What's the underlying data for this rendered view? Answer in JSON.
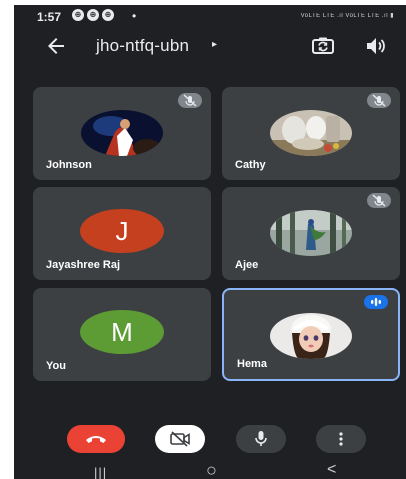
{
  "status_bar": {
    "time": "1:57",
    "notification_icons": [
      "⊕",
      "⊕",
      "⊕"
    ],
    "dot": "•",
    "signal_text": "VoLTE LTE .ıl VoLTE LTE .ıl ▮"
  },
  "top_bar": {
    "meeting_code": "jho-ntfq-ubn",
    "caret": "▸",
    "back_icon": "arrow-left-icon",
    "switch_camera_icon": "switch-camera-icon",
    "speaker_icon": "speaker-icon"
  },
  "participants": [
    {
      "name": "Johnson",
      "muted": true,
      "avatar": "photo"
    },
    {
      "name": "Cathy",
      "muted": true,
      "avatar": "photo"
    },
    {
      "name": "Jayashree Raj",
      "muted": false,
      "avatar": "letter",
      "initial": "J",
      "color": "#c5401f"
    },
    {
      "name": "Ajee",
      "muted": true,
      "avatar": "photo"
    },
    {
      "name": "You",
      "muted": false,
      "avatar": "letter",
      "initial": "M",
      "color": "#5d9c35"
    },
    {
      "name": "Hema",
      "muted": false,
      "avatar": "photo",
      "speaking": true
    }
  ],
  "controls": {
    "end_call_icon": "phone-hangup-icon",
    "camera_icon": "camera-off-icon",
    "mic_icon": "microphone-icon",
    "more_icon": "more-vert-icon"
  },
  "nav_bar": {
    "recents": "|||",
    "home": "○",
    "back": "<"
  },
  "colors": {
    "background": "#1f2023",
    "tile": "#3c4043",
    "end_call": "#ea4335",
    "active_speaker_border": "#8ab4f8"
  }
}
